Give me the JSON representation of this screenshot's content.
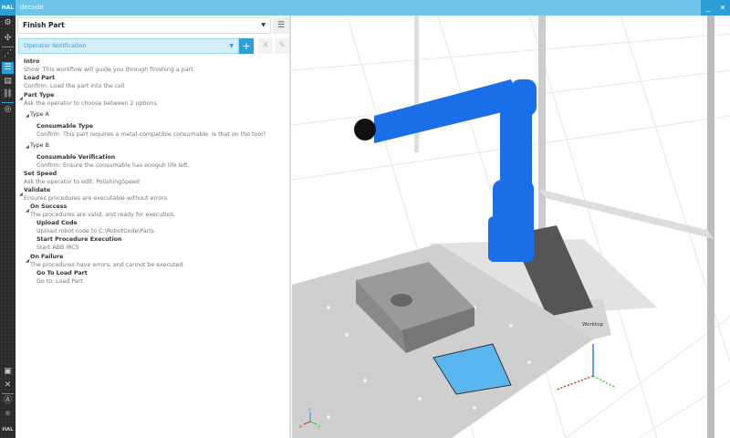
{
  "app": {
    "logo": "HAL",
    "title": "decode",
    "minimize": "_",
    "close": "✕"
  },
  "sidebar": {
    "footer_logo": "HAL"
  },
  "workflow": {
    "selected": "Finish Part",
    "step_type": "Operator Notification",
    "add": "+"
  },
  "steps": [
    {
      "title": "Intro",
      "desc": "Show: This workflow will guide you through finishing a part"
    },
    {
      "title": "Load Part",
      "desc": "Confirm: Load the part into the cell"
    },
    {
      "title": "Part Type",
      "desc": "Ask the operator to choose between 2 options."
    },
    {
      "title": "Type A"
    },
    {
      "title": "Consumable Type",
      "desc": "Confirm: This part requires a metal-compatible consumable. Is that on the tool?"
    },
    {
      "title": "Type B"
    },
    {
      "title": "Consumable Verification",
      "desc": "Confirm: Ensure the consumable has enoguh life left."
    },
    {
      "title": "Set Speed",
      "desc": "Ask the operator to edit: PolishingSpeed"
    },
    {
      "title": "Validate",
      "desc": "Ensures procedures are executable without errors."
    },
    {
      "title": "On Success",
      "desc": "The procedures are valid, and ready for execution."
    },
    {
      "title": "Upload Code",
      "desc": "Upload robot code to C:\\RobotCode\\Parts"
    },
    {
      "title": "Start Procedure Execution",
      "desc": "Start ABB IRC5"
    },
    {
      "title": "On Failure",
      "desc": "The procedures have errors, and cannot be executed."
    },
    {
      "title": "Go To Load Part",
      "desc": "Go to: Load Part"
    }
  ],
  "viewport": {
    "label": "Worktop",
    "axes": {
      "z": "z",
      "x": "x",
      "y": "y"
    }
  },
  "colors": {
    "accent": "#2d9fd8",
    "robot": "#1a6ee8"
  }
}
